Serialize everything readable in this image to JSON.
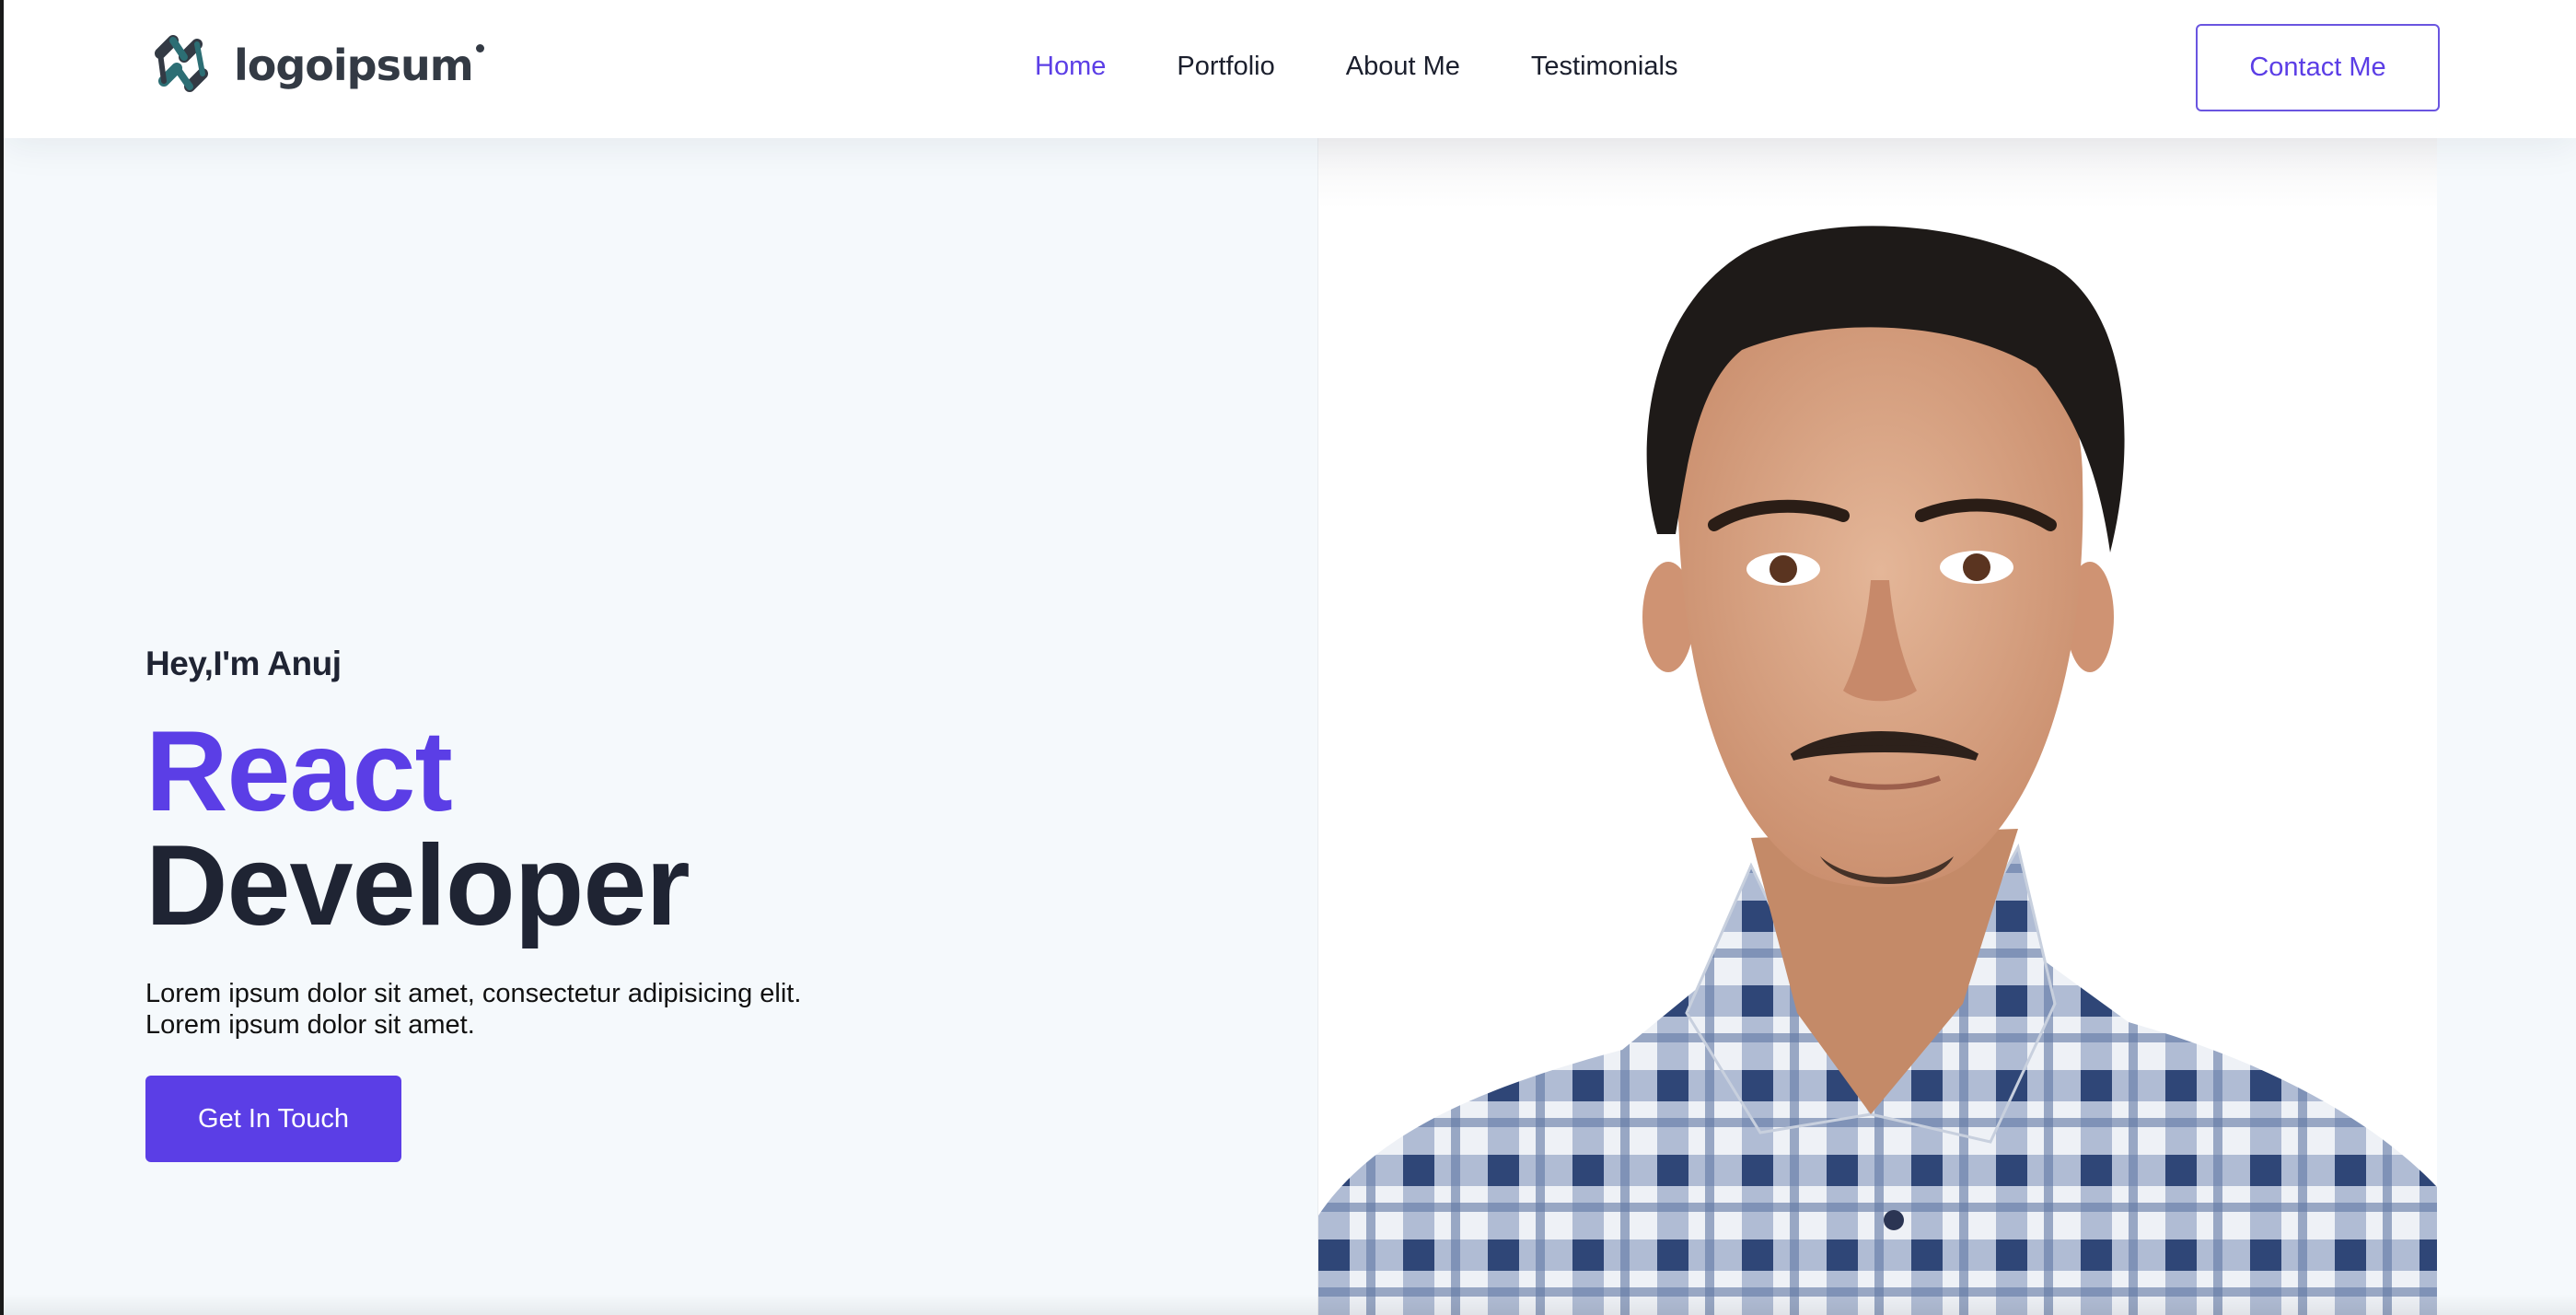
{
  "brand": {
    "logo_text": "logoipsum",
    "logo_icon": "logo-mark-icon",
    "accent_color": "#5b3ee6",
    "logo_color": "#333a44",
    "logo_teal": "#2c6e74"
  },
  "nav": {
    "items": [
      {
        "label": "Home",
        "active": true
      },
      {
        "label": "Portfolio",
        "active": false
      },
      {
        "label": "About Me",
        "active": false
      },
      {
        "label": "Testimonials",
        "active": false
      }
    ],
    "contact_label": "Contact Me"
  },
  "hero": {
    "greeting": "Hey,I'm Anuj",
    "title_accent": "React",
    "title_main": "Developer",
    "description_line1": "Lorem ipsum dolor sit amet, consectetur adipisicing elit.",
    "description_line2": "Lorem ipsum dolor sit amet.",
    "cta_label": "Get In Touch"
  },
  "colors": {
    "page_background": "#f5f9fc",
    "text_dark": "#1f2433",
    "shirt_blue": "#3f5a8a"
  }
}
